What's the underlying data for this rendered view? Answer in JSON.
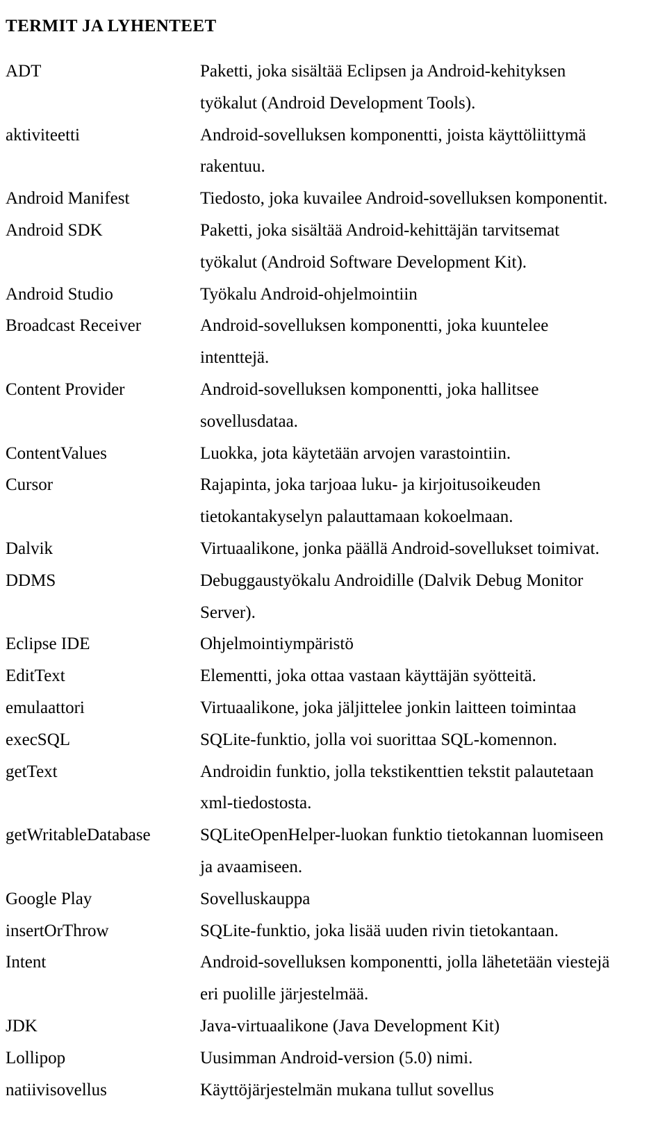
{
  "document": {
    "title": "TERMIT JA LYHENTEET",
    "language": "fi",
    "entries": [
      {
        "term": "ADT",
        "lines": [
          "Paketti, joka sisältää Eclipsen ja Android-kehityksen",
          "työkalut (Android Development Tools)."
        ]
      },
      {
        "term": "aktiviteetti",
        "lines": [
          "Android-sovelluksen komponentti, joista käyttöliittymä",
          "rakentuu."
        ]
      },
      {
        "term": "Android Manifest",
        "lines": [
          "Tiedosto, joka kuvailee Android-sovelluksen komponentit."
        ]
      },
      {
        "term": "Android SDK",
        "lines": [
          "Paketti, joka sisältää Android-kehittäjän tarvitsemat",
          "työkalut (Android Software Development Kit)."
        ]
      },
      {
        "term": "Android Studio",
        "lines": [
          "Työkalu Android-ohjelmointiin"
        ]
      },
      {
        "term": "Broadcast Receiver",
        "lines": [
          "Android-sovelluksen komponentti, joka kuuntelee",
          "intenttejä."
        ]
      },
      {
        "term": "Content Provider",
        "lines": [
          "Android-sovelluksen komponentti, joka hallitsee",
          "sovellusdataa."
        ]
      },
      {
        "term": "ContentValues",
        "lines": [
          "Luokka, jota käytetään arvojen varastointiin."
        ]
      },
      {
        "term": "Cursor",
        "lines": [
          "Rajapinta, joka tarjoaa luku- ja kirjoitusoikeuden",
          "tietokantakyselyn palauttamaan kokoelmaan."
        ]
      },
      {
        "term": "Dalvik",
        "lines": [
          "Virtuaalikone, jonka päällä Android-sovellukset toimivat."
        ]
      },
      {
        "term": "DDMS",
        "lines": [
          "Debuggaustyökalu Androidille (Dalvik Debug Monitor",
          "Server)."
        ]
      },
      {
        "term": "Eclipse IDE",
        "lines": [
          "Ohjelmointiympäristö"
        ]
      },
      {
        "term": "EditText",
        "lines": [
          "Elementti, joka ottaa vastaan käyttäjän syötteitä."
        ]
      },
      {
        "term": "emulaattori",
        "lines": [
          "Virtuaalikone, joka jäljittelee jonkin laitteen toimintaa"
        ]
      },
      {
        "term": "execSQL",
        "lines": [
          "SQLite-funktio, jolla voi suorittaa SQL-komennon."
        ]
      },
      {
        "term": "getText",
        "lines": [
          "Androidin funktio, jolla tekstikenttien tekstit palautetaan",
          "xml-tiedostosta."
        ]
      },
      {
        "term": "getWritableDatabase",
        "lines": [
          "SQLiteOpenHelper-luokan funktio tietokannan luomiseen",
          "ja avaamiseen."
        ]
      },
      {
        "term": "Google Play",
        "lines": [
          "Sovelluskauppa"
        ]
      },
      {
        "term": "insertOrThrow",
        "lines": [
          "SQLite-funktio, joka lisää uuden rivin tietokantaan."
        ]
      },
      {
        "term": "Intent",
        "lines": [
          "Android-sovelluksen komponentti, jolla lähetetään viestejä",
          "eri puolille järjestelmää."
        ]
      },
      {
        "term": "JDK",
        "lines": [
          "Java-virtuaalikone (Java Development Kit)"
        ]
      },
      {
        "term": "Lollipop",
        "lines": [
          "Uusimman Android-version (5.0) nimi."
        ]
      },
      {
        "term": "natiivisovellus",
        "lines": [
          "Käyttöjärjestelmän mukana tullut sovellus"
        ]
      }
    ]
  }
}
